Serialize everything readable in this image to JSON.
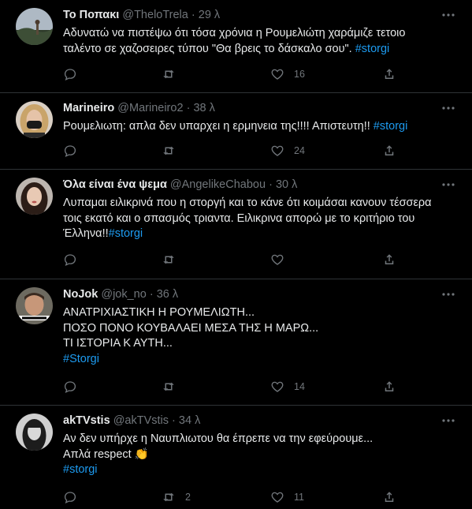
{
  "tweets": [
    {
      "name": "Το Ποπακι",
      "handle": "@TheloTrela",
      "dot": "·",
      "time": "29 λ",
      "lines": [
        {
          "text": "Αδυνατώ να πιστέψω ότι τόσα χρόνια η Ρουμελιώτη χαράμιζε τετοιο",
          "tag": ""
        },
        {
          "text": "ταλέντο σε χαζοσειρες τύπου \"Θα βρεις το δάσκαλο σου\". ",
          "tag": "#storgi"
        }
      ],
      "replies": "",
      "retweets": "",
      "likes": "16",
      "avatar_icon": "landscape-avatar"
    },
    {
      "name": "Marineiro",
      "handle": "@Marineiro2",
      "dot": "·",
      "time": "38 λ",
      "lines": [
        {
          "text": "Ρουμελιωτη: απλα δεν υπαρχει η ερμηνεια της!!!! Απιστευτη!!  ",
          "tag": "#storgi"
        }
      ],
      "replies": "",
      "retweets": "",
      "likes": "24",
      "avatar_icon": "blonde-woman-avatar"
    },
    {
      "name": "Όλα είναι ένα ψεμα",
      "handle": "@AngelikeChabou",
      "dot": "·",
      "time": "30 λ",
      "lines": [
        {
          "text": "Λυπαμαι ειλικρινά που η στοργή και το κάνε ότι κοιμάσαι κανουν τέσσερα",
          "tag": ""
        },
        {
          "text": "τοις εκατό και ο σπασμός τριαντα. Ειλικρινα απορώ με το κριτήριο του",
          "tag": ""
        },
        {
          "text": "Έλληνα!!",
          "tag": "#storgi"
        }
      ],
      "replies": "",
      "retweets": "",
      "likes": "",
      "avatar_icon": "dark-hair-woman-avatar"
    },
    {
      "name": "NoJok",
      "handle": "@jok_no",
      "dot": "·",
      "time": "36 λ",
      "lines": [
        {
          "text": "ΑΝΑΤΡΙΧΙΑΣΤΙΚΗ Η ΡΟΥΜΕΛΙΩΤΗ...",
          "tag": ""
        },
        {
          "text": "ΠΟΣΟ ΠΟΝΟ ΚΟΥΒΑΛΑΕΙ ΜΕΣΑ ΤΗΣ Η ΜΑΡΩ...",
          "tag": ""
        },
        {
          "text": "ΤΙ ΙΣΤΟΡΙΑ Κ ΑΥΤΗ...",
          "tag": ""
        },
        {
          "text": "",
          "tag": "#Storgi"
        }
      ],
      "replies": "",
      "retweets": "",
      "likes": "14",
      "avatar_icon": "meme-man-avatar"
    },
    {
      "name": "akTVstis",
      "handle": "@akTVstis",
      "dot": "·",
      "time": "34 λ",
      "lines": [
        {
          "text": "Αν δεν υπήρχε η Ναυπλιωτου θα έπρεπε να την εφεύρουμε...",
          "tag": ""
        },
        {
          "text": "Απλά respect ",
          "tag": "",
          "emoji": "👏"
        },
        {
          "text": "",
          "tag": "#storgi"
        }
      ],
      "replies": "",
      "retweets": "2",
      "likes": "11",
      "avatar_icon": "bw-woman-avatar"
    }
  ],
  "colors": {
    "background": "#000000",
    "text": "#e7e9ea",
    "muted": "#71767b",
    "hashtag": "#1d9bf0",
    "divider": "#2f3336"
  }
}
